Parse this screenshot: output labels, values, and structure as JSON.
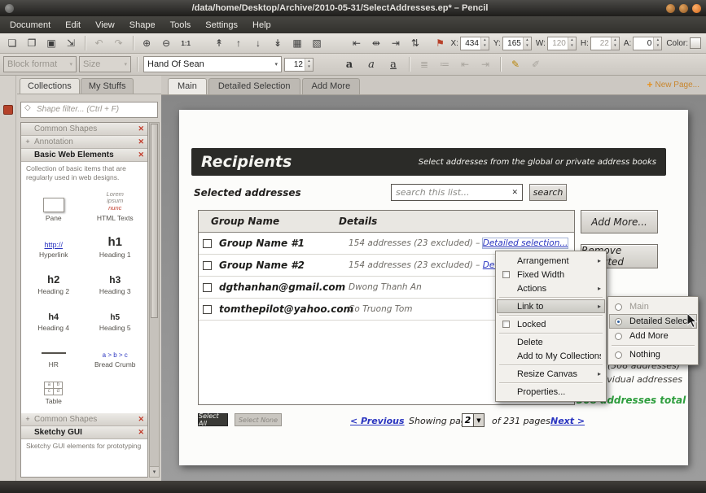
{
  "window": {
    "title": "/data/home/Desktop/Archive/2010-05-31/SelectAddresses.ep* – Pencil"
  },
  "menubar": [
    "Document",
    "Edit",
    "View",
    "Shape",
    "Tools",
    "Settings",
    "Help"
  ],
  "toolbar": {
    "icons": {
      "new": "❏",
      "open": "❐",
      "save": "▣",
      "export": "⇲",
      "undo": "↶",
      "redo": "↷",
      "zoom_in": "⊕",
      "zoom_out": "⊖",
      "zoom_actual": "1:1",
      "bring_to_front": "↟",
      "bring_forward": "↑",
      "send_backward": "↓",
      "send_to_back": "↡",
      "group": "▦",
      "ungroup": "▧",
      "align_left": "⇤",
      "align_center": "⇹",
      "align_right": "⇥",
      "align_middle": "⇅",
      "marker": "⚑",
      "spin_up": "▴",
      "spin_down": "▾",
      "caret": "▾"
    },
    "fields": [
      {
        "label": "X:",
        "value": "434"
      },
      {
        "label": "Y:",
        "value": "165"
      },
      {
        "label": "W:",
        "value": "120"
      },
      {
        "label": "H:",
        "value": "22"
      },
      {
        "label": "A:",
        "value": "0"
      }
    ],
    "color_label": "Color:"
  },
  "format_bar": {
    "block_format": "Block format",
    "size": "Size",
    "font": "Hand Of Sean",
    "font_size": "12",
    "bold": "a",
    "italic": "a",
    "underline": "a",
    "icons": {
      "bullet_list": "≣",
      "numbered_list": "≔",
      "outdent": "⇤",
      "indent": "⇥",
      "highlight": "✎",
      "pencil": "✐"
    }
  },
  "sidebar": {
    "tabs": [
      "Collections",
      "My Stuffs"
    ],
    "filter_placeholder": "Shape filter... (Ctrl + F)",
    "filter_icon": "◇",
    "expand_icon": "+",
    "close_icon": "✕",
    "sections": {
      "common_shapes": "Common Shapes",
      "annotation": "Annotation",
      "basic_web": "Basic Web Elements",
      "basic_web_desc": "Collection of basic items that are regularly used in web designs.",
      "common_shapes_2": "Common Shapes",
      "sketchy_gui": "Sketchy GUI",
      "sketchy_gui_desc": "Sketchy GUI elements for prototyping"
    },
    "items": [
      {
        "label": "Pane"
      },
      {
        "label": "HTML Texts",
        "preview_line1": "Lorem",
        "preview_line2": "ipsum",
        "preview_accent": "nunc"
      },
      {
        "label": "Hyperlink",
        "preview": "http://"
      },
      {
        "label": "Heading 1",
        "preview": "h1"
      },
      {
        "label": "Heading 2",
        "preview": "h2"
      },
      {
        "label": "Heading 3",
        "preview": "h3"
      },
      {
        "label": "Heading 4",
        "preview": "h4"
      },
      {
        "label": "Heading 5",
        "preview": "h5"
      },
      {
        "label": "HR"
      },
      {
        "label": "Bread Crumb",
        "preview": "a > b > c"
      },
      {
        "label": "Table",
        "cells": [
          "a",
          "b",
          "c",
          "d"
        ]
      }
    ]
  },
  "page_tabs": {
    "tabs": [
      "Main",
      "Detailed Selection",
      "Add More"
    ],
    "plus": "+",
    "new_page": "New Page..."
  },
  "wireframe": {
    "title": "Recipients",
    "subtitle": "Select addresses from the global or private address books",
    "selected_label": "Selected addresses",
    "search_text": "search this list...",
    "clear_icon": "✕",
    "search_button": "search",
    "columns": [
      "Group Name",
      "Details"
    ],
    "rows": [
      {
        "name": "Group Name #1",
        "details": "154 addresses (23 excluded) – ",
        "link": "Detailed selection..."
      },
      {
        "name": "Group Name #2",
        "details": "154 addresses (23 excluded) – ",
        "link": "Detailed selection..."
      },
      {
        "name": "dgthanhan@gmail.com",
        "details": "Dwong Thanh An"
      },
      {
        "name": "tomthepilot@yahoo.com",
        "details": "Co Truong Tom"
      }
    ],
    "add_more": "Add More...",
    "remove_selected": "Remove Selected",
    "groups_label": "Groups (308 addresses)",
    "individual_label": "Individual addresses",
    "total_label": "308 addresses total",
    "select_all": "Select All",
    "select_none": "Select None",
    "previous": "< Previous",
    "showing_page": "Showing page:",
    "page_number": "2",
    "caret": "▼",
    "of_pages": "of 231 pages",
    "next": "Next >"
  },
  "context_menu": {
    "arrow": "▸",
    "arrangement": "Arrangement",
    "fixed_width": "Fixed Width",
    "actions": "Actions",
    "link_to": "Link to",
    "locked": "Locked",
    "delete": "Delete",
    "add_to_collections": "Add to My Collections...",
    "resize_canvas": "Resize Canvas",
    "properties": "Properties...",
    "submenu": [
      "Main",
      "Detailed Selection",
      "Add More",
      "Nothing"
    ]
  },
  "scrollbar": {
    "down": "▾"
  },
  "colors": {
    "link_blue": "#2a35c0",
    "total_green": "#2e9e3e",
    "wireframe_header": "#2b2b28",
    "new_page_orange": "#c8862e"
  }
}
